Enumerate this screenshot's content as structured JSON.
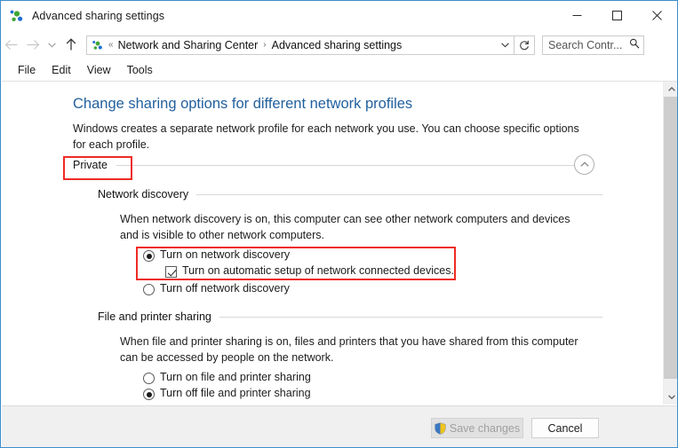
{
  "window": {
    "title": "Advanced sharing settings",
    "icon": "network-sharing-icon",
    "minimize_label": "─",
    "maximize_label": "□",
    "close_label": "✕"
  },
  "addressbar": {
    "back_label": "←",
    "forward_label": "→",
    "recent_label": "⌄",
    "up_label": "↑",
    "prefix": "«",
    "crumbs": [
      "Network and Sharing Center",
      "Advanced sharing settings"
    ],
    "separator": "›",
    "dropdown_label": "⌄",
    "refresh_label": "↻"
  },
  "search": {
    "value": "Search Contr...",
    "placeholder": "Search Control Panel",
    "icon": "search-icon"
  },
  "menubar": {
    "items": [
      "File",
      "Edit",
      "View",
      "Tools"
    ]
  },
  "main": {
    "heading": "Change sharing options for different network profiles",
    "intro": "Windows creates a separate network profile for each network you use. You can choose specific options for each profile.",
    "profile": {
      "name": "Private",
      "collapse_icon": "chevron-up-icon"
    },
    "sections": [
      {
        "title": "Network discovery",
        "description": "When network discovery is on, this computer can see other network computers and devices and is visible to other network computers.",
        "options": [
          {
            "type": "radio",
            "label": "Turn on network discovery",
            "checked": true
          },
          {
            "type": "checkbox",
            "label": "Turn on automatic setup of network connected devices.",
            "checked": true,
            "indent": true
          },
          {
            "type": "radio",
            "label": "Turn off network discovery",
            "checked": false
          }
        ]
      },
      {
        "title": "File and printer sharing",
        "description": "When file and printer sharing is on, files and printers that you have shared from this computer can be accessed by people on the network.",
        "options": [
          {
            "type": "radio",
            "label": "Turn on file and printer sharing",
            "checked": false
          },
          {
            "type": "radio",
            "label": "Turn off file and printer sharing",
            "checked": true
          }
        ]
      }
    ]
  },
  "footer": {
    "save_label": "Save changes",
    "save_icon": "uac-shield-icon",
    "save_disabled": true,
    "cancel_label": "Cancel"
  },
  "scrollbar": {
    "up_arrow": "⌃",
    "down_arrow": "⌄"
  },
  "annotations": {
    "highlight_color": "#ee2b24",
    "boxes": [
      "private-profile-header",
      "network-discovery-on-options"
    ]
  }
}
